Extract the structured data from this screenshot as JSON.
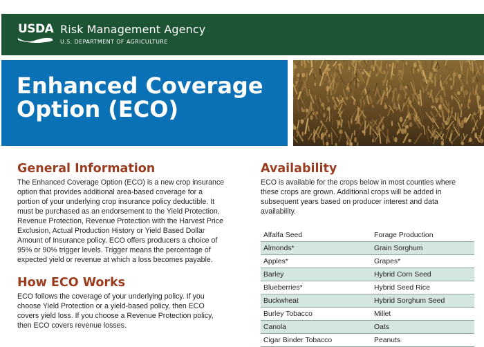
{
  "header": {
    "logo_text": "USDA",
    "agency": "Risk Management Agency",
    "department": "U.S. DEPARTMENT OF AGRICULTURE"
  },
  "title": {
    "line1": "Enhanced Coverage",
    "line2": "Option (ECO)"
  },
  "general": {
    "heading": "General Information",
    "lines": [
      "The Enhanced Coverage Option (ECO) is a new crop insurance",
      "option that provides additional area-based coverage for a",
      "portion of your underlying crop insurance policy deductible. It",
      "must be purchased as an endorsement to the Yield Protection,",
      "Revenue Protection, Revenue Protection with the Harvest Price",
      "Exclusion, Actual Production History or Yield Based Dollar",
      "Amount of Insurance policy. ECO offers producers a choice of",
      "95% or 90% trigger levels. Trigger means the percentage of",
      "expected yield or revenue at which a loss becomes payable."
    ]
  },
  "how": {
    "heading": "How ECO Works",
    "lines": [
      "ECO follows the coverage of your underlying policy. If you",
      "choose Yield Protection or a yield-based policy, then ECO",
      "covers yield loss. If you choose a Revenue Protection policy,",
      "then ECO covers revenue losses."
    ]
  },
  "availability": {
    "heading": "Availability",
    "lines": [
      "ECO is available for the crops below in most counties where",
      "these crops are grown. Additional crops will be added in",
      "subsequent years based on producer interest and data",
      "availability."
    ],
    "crops": [
      [
        "Alfalfa Seed",
        "Forage Production"
      ],
      [
        "Almonds*",
        "Grain Sorghum"
      ],
      [
        "Apples*",
        "Grapes*"
      ],
      [
        "Barley",
        "Hybrid Corn Seed"
      ],
      [
        "Blueberries*",
        "Hybrid Seed Rice"
      ],
      [
        "Buckwheat",
        "Hybrid Sorghum Seed"
      ],
      [
        "Burley Tobacco",
        "Millet"
      ],
      [
        "Canola",
        "Oats"
      ],
      [
        "Cigar Binder Tobacco",
        "Peanuts"
      ]
    ]
  },
  "colors": {
    "header_green": "#1d5534",
    "title_blue": "#0b71b6",
    "heading_rust": "#9b3c1f",
    "row_shade": "#d4e6df"
  }
}
